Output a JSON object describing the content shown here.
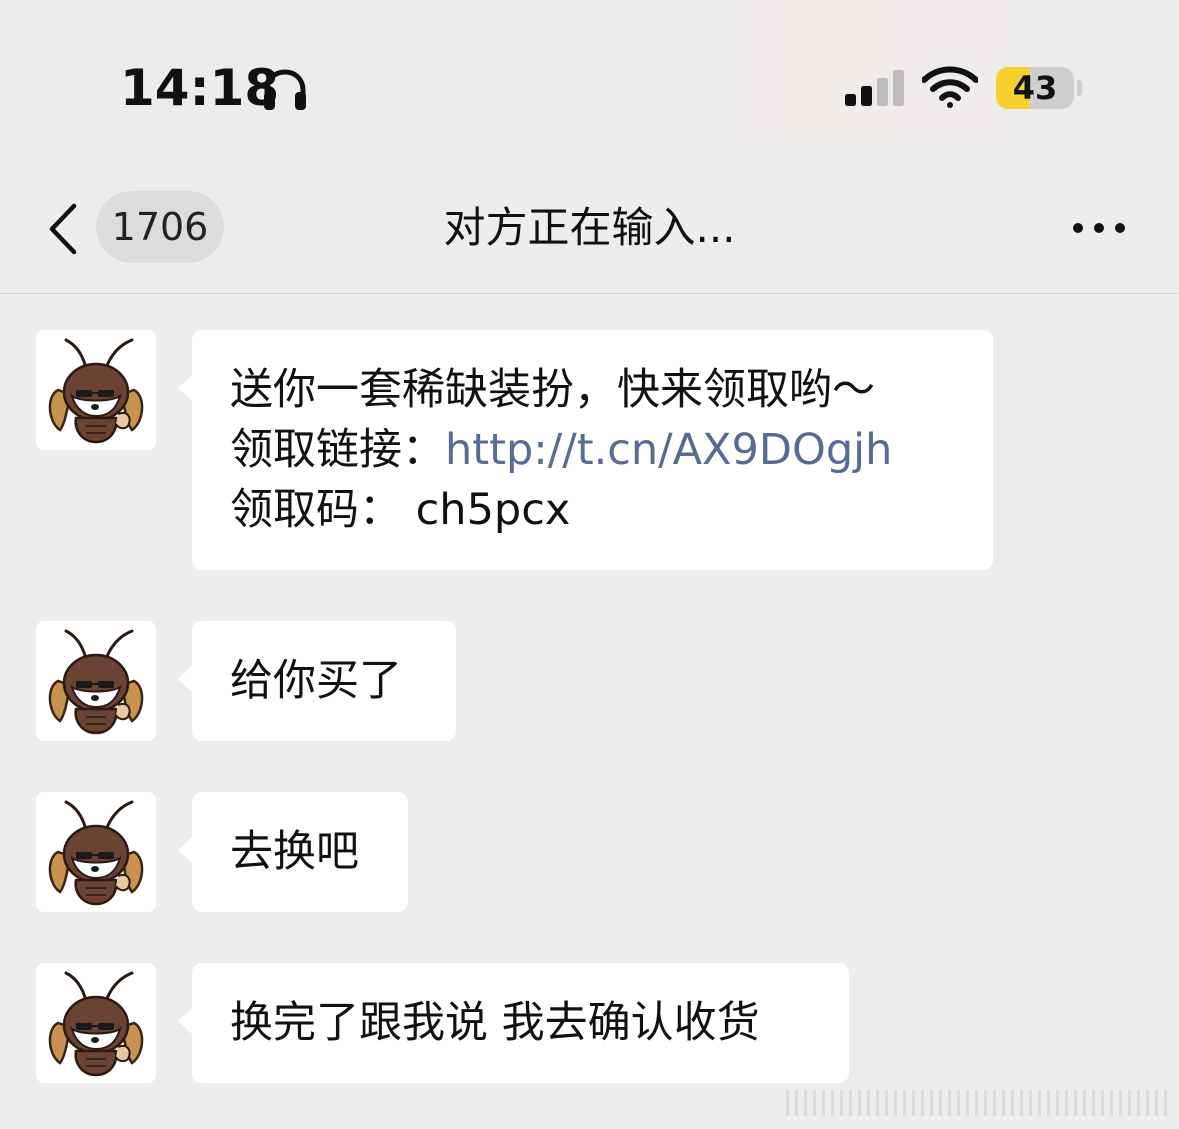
{
  "status_bar": {
    "time": "14:18",
    "battery_level": "43",
    "battery_percent": 43,
    "icons": [
      "headphone-icon",
      "cellular-signal-icon",
      "wifi-icon",
      "battery-icon"
    ]
  },
  "nav": {
    "back_icon": "chevron-left-icon",
    "unread_count": "1706",
    "title": "对方正在输入...",
    "more_icon": "more-dots-icon"
  },
  "colors": {
    "background": "#ededed",
    "bubble": "#ffffff",
    "link": "#576b95",
    "battery_fill": "#f7d12f",
    "avatar_body": "#6b4332"
  },
  "messages": [
    {
      "sender": "other",
      "avatar_icon": "cockroach-dog-avatar",
      "lines": [
        {
          "label": "送你一套稀缺装扮，快来领取哟～",
          "value": ""
        },
        {
          "label": "领取链接：",
          "value": "http://t.cn/AX9DOgjh"
        },
        {
          "label": "领取码：",
          "value": " ch5pcx"
        }
      ]
    },
    {
      "sender": "other",
      "avatar_icon": "cockroach-dog-avatar",
      "text": "给你买了"
    },
    {
      "sender": "other",
      "avatar_icon": "cockroach-dog-avatar",
      "text": "去换吧"
    },
    {
      "sender": "other",
      "avatar_icon": "cockroach-dog-avatar",
      "text": "换完了跟我说 我去确认收货"
    }
  ]
}
